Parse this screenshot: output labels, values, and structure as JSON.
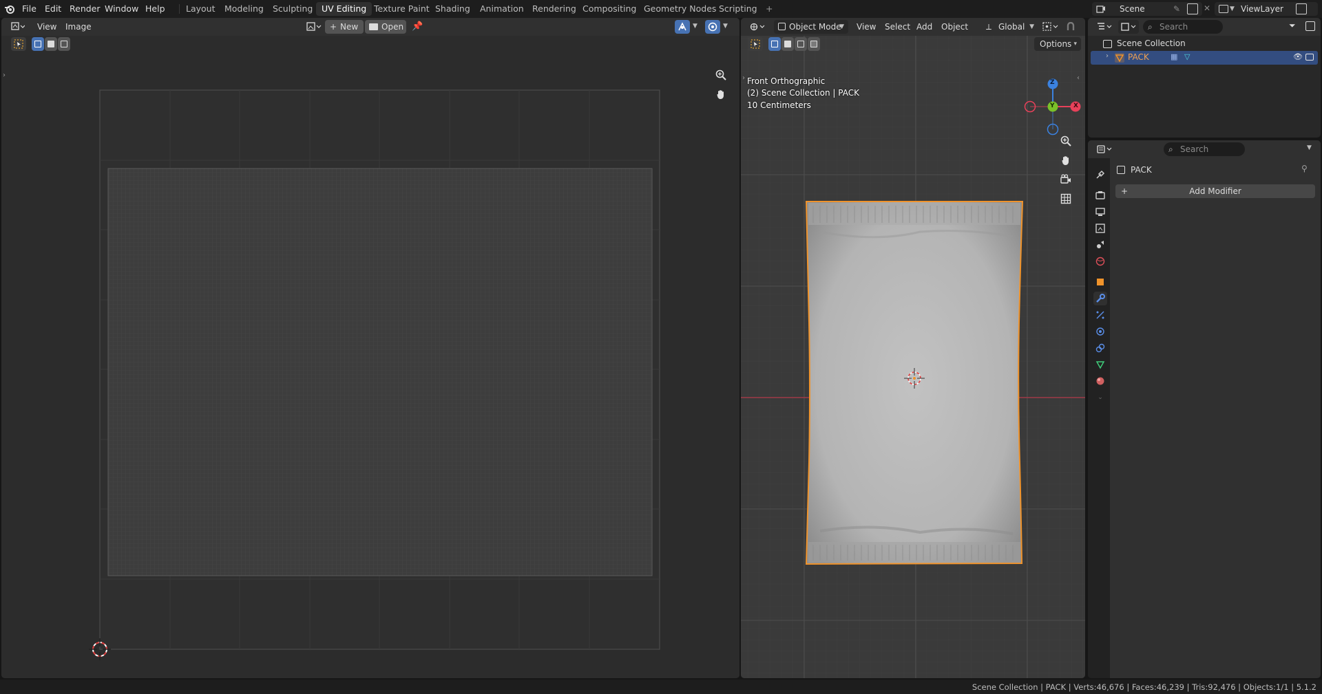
{
  "topbar": {
    "menus": [
      "File",
      "Edit",
      "Render",
      "Window",
      "Help"
    ],
    "workspaces": [
      "Layout",
      "Modeling",
      "Sculpting",
      "UV Editing",
      "Texture Paint",
      "Shading",
      "Animation",
      "Rendering",
      "Compositing",
      "Geometry Nodes",
      "Scripting"
    ],
    "active_workspace": "UV Editing",
    "add_workspace": "+",
    "scene_name": "Scene",
    "view_layer": "ViewLayer"
  },
  "uv_editor": {
    "menus": [
      "View",
      "Image"
    ],
    "new_label": "New",
    "open_label": "Open"
  },
  "viewport": {
    "mode_label": "Object Mode",
    "menus": [
      "View",
      "Select",
      "Add",
      "Object"
    ],
    "orientation_label": "Global",
    "options_label": "Options",
    "view_name": "Front Orthographic",
    "collection_info": "(2) Scene Collection | PACK",
    "scale_info": "10 Centimeters",
    "gizmo": {
      "z": "Z",
      "y": "Y",
      "x": "X"
    }
  },
  "outliner": {
    "search_placeholder": "Search",
    "root": "Scene Collection",
    "object": "PACK"
  },
  "properties": {
    "search_placeholder": "Search",
    "object_name": "PACK",
    "add_modifier_label": "Add Modifier"
  },
  "statusbar": {
    "text": "Scene Collection | PACK | Verts:46,676 | Faces:46,239 | Tris:92,476 | Objects:1/1 | 5.1.2"
  },
  "colors": {
    "accent": "#4772b3",
    "selection_outline": "#f0932b",
    "axis_x": "#e8415a",
    "axis_y": "#7ac229",
    "axis_z": "#3b82e0"
  }
}
